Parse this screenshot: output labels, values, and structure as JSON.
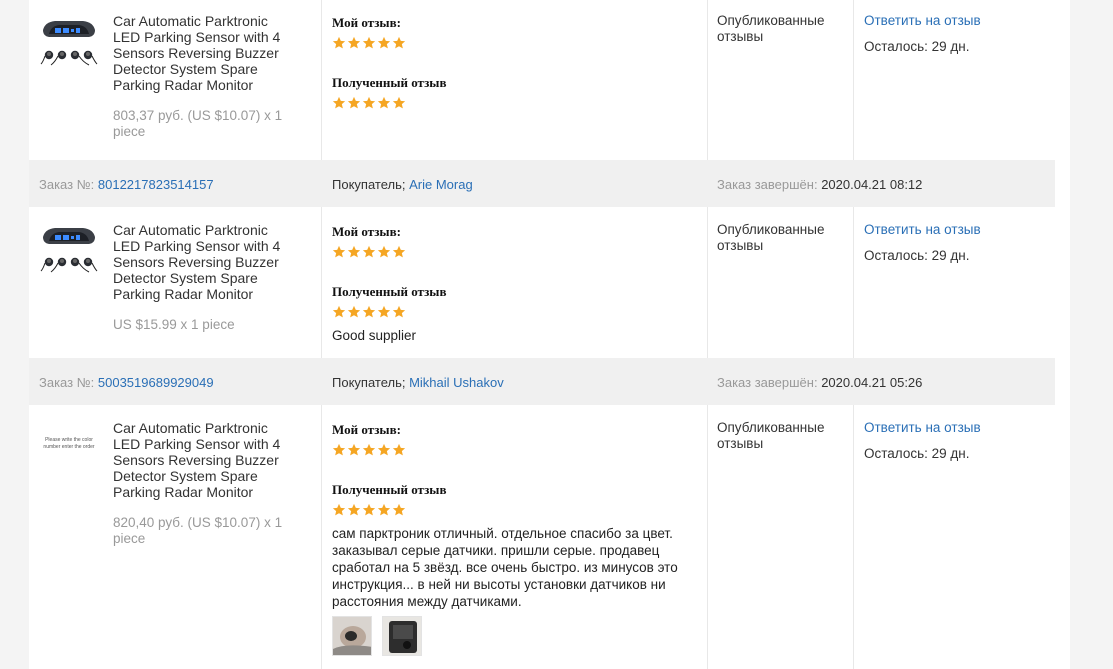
{
  "header_labels": {
    "order_label": "Заказ №: ",
    "buyer_label": "Покупатель; ",
    "completed_label": "Заказ завершён: "
  },
  "review_labels": {
    "my_review": "Мой отзыв:",
    "received_review": "Полученный отзыв"
  },
  "orders": [
    {
      "order_no": "",
      "buyer": "",
      "completed_at": "",
      "product_title": "Car Automatic Parktronic LED Parking Sensor with 4 Sensors Reversing Buzzer Detector System Spare Parking Radar Monitor",
      "price": "803,37 руб. (US $10.07) x 1 piece",
      "my_review_stars": 5,
      "received_review_stars": 5,
      "received_review_text": "",
      "status": "Опубликованные отзывы",
      "reply_link": "Ответить на отзыв",
      "remaining": "Осталось: 29 дн."
    },
    {
      "order_no": "8012217823514157",
      "buyer": "Arie Morag",
      "completed_at": "2020.04.21 08:12",
      "product_title": "Car Automatic Parktronic LED Parking Sensor with 4 Sensors Reversing Buzzer Detector System Spare Parking Radar Monitor",
      "price": "US $15.99 x 1 piece",
      "my_review_stars": 5,
      "received_review_stars": 5,
      "received_review_text": "Good supplier",
      "status": "Опубликованные отзывы",
      "reply_link": "Ответить на отзыв",
      "remaining": "Осталось: 29 дн."
    },
    {
      "order_no": "5003519689929049",
      "buyer": "Mikhail Ushakov",
      "completed_at": "2020.04.21 05:26",
      "product_title": "Car Automatic Parktronic LED Parking Sensor with 4 Sensors Reversing Buzzer Detector System Spare Parking Radar Monitor",
      "price": "820,40 руб. (US $10.07) x 1 piece",
      "thumbnail_caption": "Please write the color number enter the order",
      "my_review_stars": 5,
      "received_review_stars": 5,
      "received_review_text": "сам парктроник отличный. отдельное спасибо за цвет. заказывал серые датчики. пришли серые. продавец сработал на 5 звёзд. все очень быстро. из минусов это инструкция... в ней ни высоты установки датчиков ни расстояния между датчиками.",
      "status": "Опубликованные отзывы",
      "reply_link": "Ответить на отзыв",
      "remaining": "Осталось: 29 дн."
    }
  ],
  "colors": {
    "star": "#f5a623",
    "link": "#2a6fb6",
    "header_bg": "#f0f0f0",
    "muted": "#999999"
  },
  "icons": [
    "star-icon",
    "parking-sensor-product-image",
    "review-photo"
  ]
}
